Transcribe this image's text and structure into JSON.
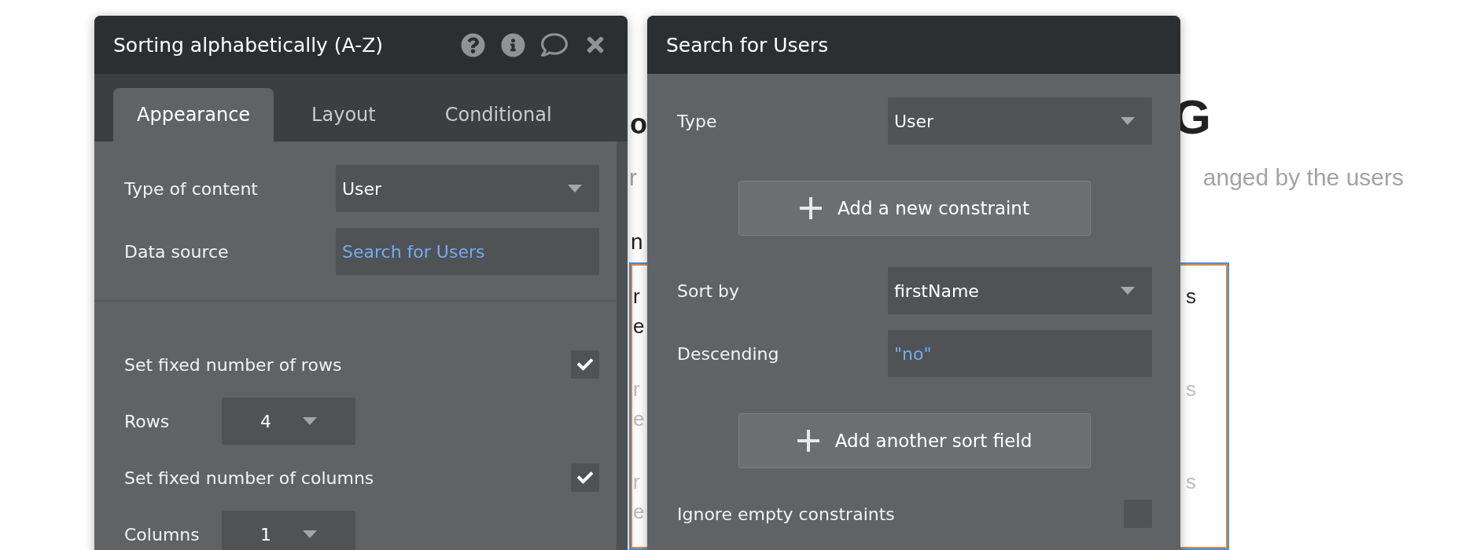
{
  "background_page": {
    "heading": [
      "o",
      "G"
    ],
    "subtitle": [
      "r",
      "anged by the users"
    ],
    "label": "n",
    "rows": [
      {
        "lines": [
          "r",
          "e"
        ],
        "end": "s",
        "dimmed": false
      },
      {
        "lines": [
          "r",
          "e"
        ],
        "end": "s",
        "dimmed": true
      },
      {
        "lines": [
          "r",
          "e"
        ],
        "end": "s",
        "dimmed": true
      }
    ]
  },
  "element_panel": {
    "title": "Sorting alphabetically (A-Z)",
    "tabs": [
      {
        "label": "Appearance",
        "selected": true
      },
      {
        "label": "Layout",
        "selected": false
      },
      {
        "label": "Conditional",
        "selected": false
      }
    ],
    "fields": [
      {
        "kind": "dropdown",
        "label": "Type of content",
        "value": "User"
      },
      {
        "kind": "expression",
        "label": "Data source",
        "value": "Search for Users"
      }
    ],
    "options": [
      {
        "kind": "checkbox",
        "label": "Set fixed number of rows",
        "checked": true
      },
      {
        "kind": "dropdown",
        "label": "Rows",
        "value": "4"
      },
      {
        "kind": "checkbox",
        "label": "Set fixed number of columns",
        "checked": true
      },
      {
        "kind": "dropdown",
        "label": "Columns",
        "value": "1"
      }
    ]
  },
  "search_panel": {
    "title": "Search for Users",
    "items": [
      {
        "kind": "dropdown",
        "label": "Type",
        "value": "User"
      },
      {
        "kind": "button",
        "label": "Add a new constraint"
      },
      {
        "kind": "dropdown",
        "label": "Sort by",
        "value": "firstName"
      },
      {
        "kind": "expression",
        "label": "Descending",
        "value": "\"no\""
      },
      {
        "kind": "button",
        "label": "Add another sort field"
      },
      {
        "kind": "checkbox",
        "label": "Ignore empty constraints",
        "checked": false
      }
    ]
  }
}
